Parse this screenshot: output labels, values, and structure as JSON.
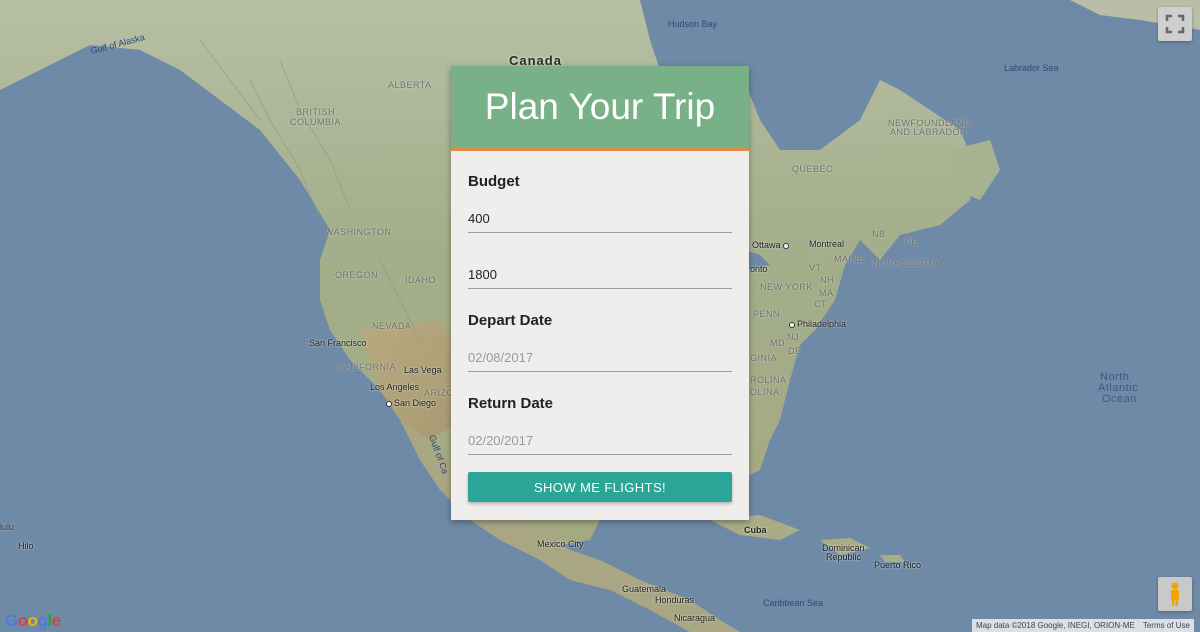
{
  "map": {
    "labels": {
      "canada": "Canada",
      "hudson_bay": "Hudson Bay",
      "gulf_of_alaska": "Gulf of Alaska",
      "labrador_sea": "Labrador Sea",
      "alberta": "ALBERTA",
      "british_columbia_1": "BRITISH",
      "british_columbia_2": "COLUMBIA",
      "newfoundland_1": "NEWFOUNDLAND",
      "newfoundland_2": "AND LABRADOR",
      "quebec": "QUEBEC",
      "washington": "WASHINGTON",
      "oregon": "OREGON",
      "idaho": "IDAHO",
      "nevada": "NEVADA",
      "california": "CALIFORNIA",
      "arizona": "ARIZO",
      "nb": "NB",
      "pe": "PE",
      "maine": "MAINE",
      "nova_scotia": "NOVA SCOTIA",
      "vt": "VT",
      "nh": "NH",
      "ma": "MA",
      "new_york": "NEW YORK",
      "ct": "CT",
      "penn": "PENN",
      "nj": "NJ",
      "de": "DE",
      "md": "MD",
      "virginia": "GINIA",
      "carolina": "ROLINA",
      "carolina_2": "OLINA",
      "north_atlantic_1": "North",
      "north_atlantic_2": "Atlantic",
      "north_atlantic_3": "Ocean",
      "gulf_of_california": "Gulf of Ca",
      "caribbean_sea": "Caribbean Sea",
      "lulu": "lulu",
      "hilo": "Hilo"
    },
    "cities": {
      "ottawa": "Ottawa",
      "montreal": "Montreal",
      "toronto": "onto",
      "philadelphia": "Philadelphia",
      "san_francisco": "San Francisco",
      "las_vegas": "Las Vega",
      "los_angeles": "Los Angeles",
      "san_diego": "San Diego",
      "mexico_city": "Mexico City",
      "cuba": "Cuba",
      "dominican_republic_1": "Dominican",
      "dominican_republic_2": "Republic",
      "puerto_rico": "Puerto Rico",
      "guatemala": "Guatemala",
      "honduras": "Honduras",
      "nicaragua": "Nicaragua"
    },
    "attribution": "Map data ©2018 Google, INEGI, ORION-ME",
    "terms": "Terms of Use",
    "logo": [
      "G",
      "o",
      "o",
      "g",
      "l",
      "e"
    ],
    "colors": {
      "water": "#6f8aa6",
      "land": "#a8b394"
    }
  },
  "panel": {
    "title": "Plan Your Trip",
    "header_color": "#78b087",
    "header_border_color": "#e08a4a",
    "budget_label": "Budget",
    "budget_min_value": "400",
    "budget_max_value": "1800",
    "depart_label": "Depart Date",
    "depart_placeholder": "02/08/2017",
    "return_label": "Return Date",
    "return_placeholder": "02/20/2017",
    "submit_label": "SHOW ME FLIGHTS!",
    "submit_color": "#2ba595"
  }
}
